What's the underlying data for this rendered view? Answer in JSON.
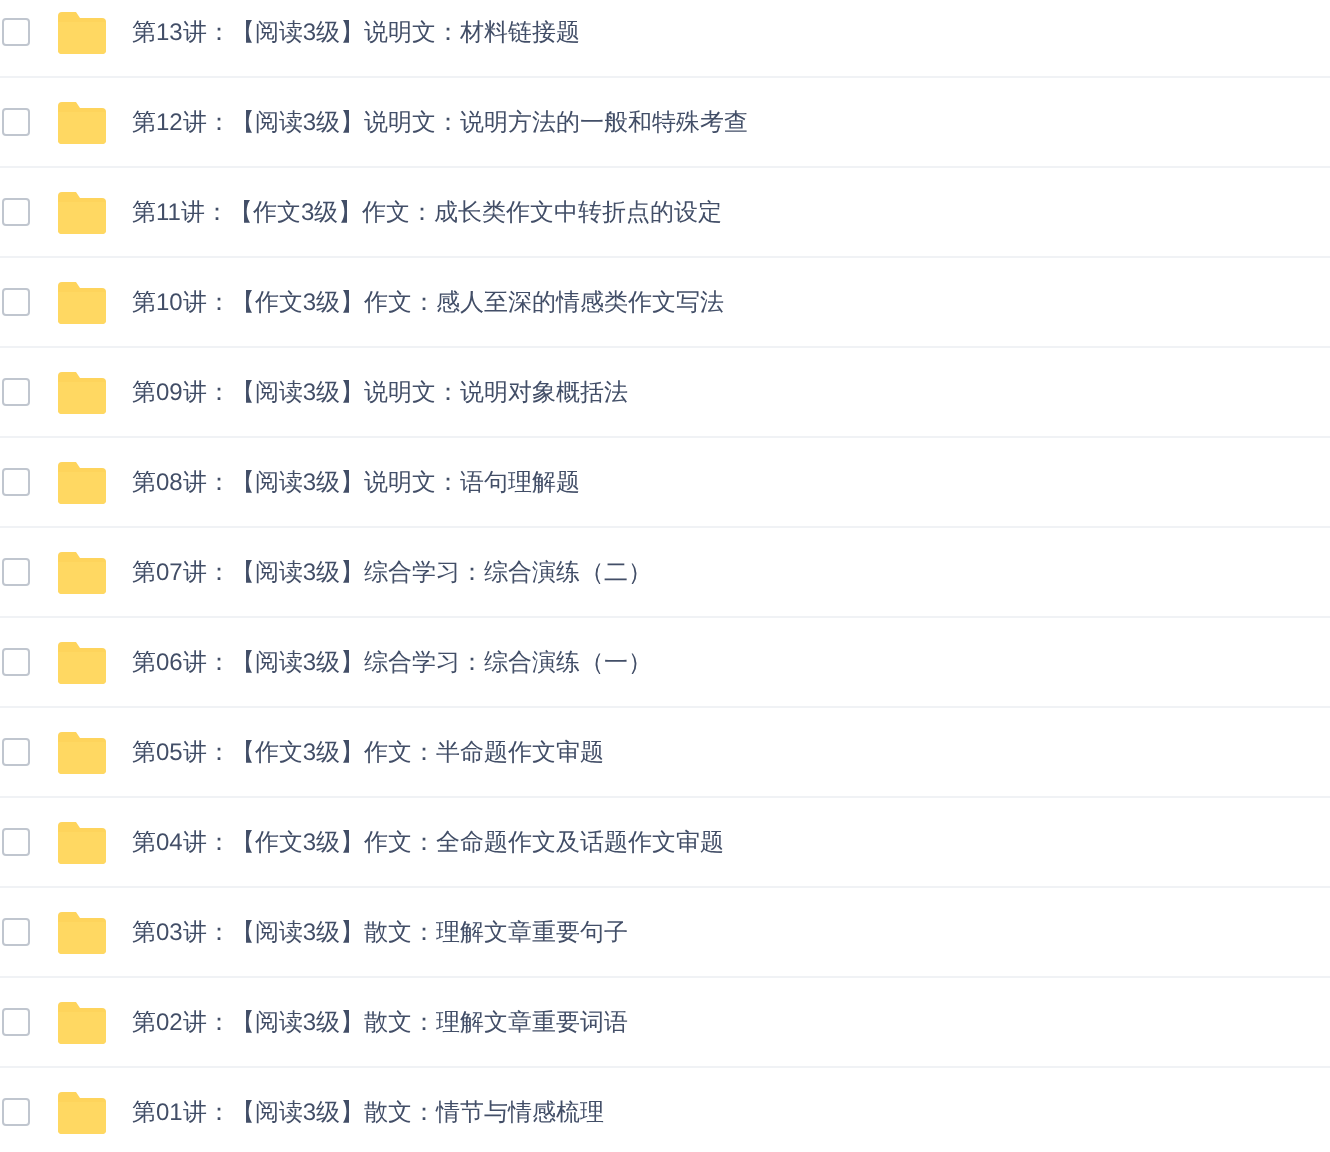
{
  "items": [
    {
      "name": "第13讲：【阅读3级】说明文：材料链接题",
      "checked": false
    },
    {
      "name": "第12讲：【阅读3级】说明文：说明方法的一般和特殊考查",
      "checked": false
    },
    {
      "name": "第11讲：【作文3级】作文：成长类作文中转折点的设定",
      "checked": false
    },
    {
      "name": "第10讲：【作文3级】作文：感人至深的情感类作文写法",
      "checked": false
    },
    {
      "name": "第09讲：【阅读3级】说明文：说明对象概括法",
      "checked": false
    },
    {
      "name": "第08讲：【阅读3级】说明文：语句理解题",
      "checked": false
    },
    {
      "name": "第07讲：【阅读3级】综合学习：综合演练（二）",
      "checked": false
    },
    {
      "name": "第06讲：【阅读3级】综合学习：综合演练（一）",
      "checked": false
    },
    {
      "name": "第05讲：【作文3级】作文：半命题作文审题",
      "checked": false
    },
    {
      "name": "第04讲：【作文3级】作文：全命题作文及话题作文审题",
      "checked": false
    },
    {
      "name": "第03讲：【阅读3级】散文：理解文章重要句子",
      "checked": false
    },
    {
      "name": "第02讲：【阅读3级】散文：理解文章重要词语",
      "checked": false
    },
    {
      "name": "第01讲：【阅读3级】散文：情节与情感梳理",
      "checked": false
    }
  ]
}
